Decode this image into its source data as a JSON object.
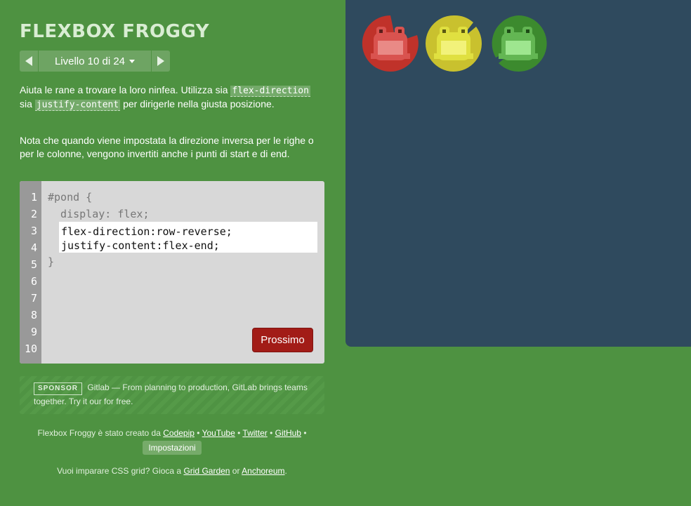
{
  "title": "FLEXBOX FROGGY",
  "level_nav": {
    "label": "Livello 10 di 24",
    "prev_icon": "triangle-left-icon",
    "next_icon": "triangle-right-icon"
  },
  "instructions": {
    "p1_part1": "Aiuta le rane a trovare la loro ninfea. Utilizza sia ",
    "p1_code1": "flex-direction",
    "p1_part2": " sia ",
    "p1_code2": "justify-content",
    "p1_part3": " per dirigerle nella giusta posizione.",
    "p2": "Nota che quando viene impostata la direzione inversa per le righe o per le colonne, vengono invertiti anche i punti di start e di end."
  },
  "editor": {
    "line_numbers": [
      "1",
      "2",
      "3",
      "4",
      "5",
      "6",
      "7",
      "8",
      "9",
      "10"
    ],
    "line1": "#pond {",
    "line2": "  display: flex;",
    "input_value": "flex-direction:row-reverse;\njustify-content:flex-end;",
    "line5": "}",
    "next_button": "Prossimo"
  },
  "sponsor": {
    "badge": "SPONSOR",
    "text": "Gitlab — From planning to production, GitLab brings teams together. Try it our for free."
  },
  "footer": {
    "credit_prefix": "Flexbox Froggy è stato creato da ",
    "link_codepip": "Codepip",
    "link_youtube": "YouTube",
    "link_twitter": "Twitter",
    "link_github": "GitHub",
    "separator": " • ",
    "settings": "Impostazioni",
    "grid_prefix": "Vuoi imparare CSS grid? Gioca a ",
    "link_grid_garden": "Grid Garden",
    "or": " or ",
    "link_anchoreum": "Anchoreum",
    "period": "."
  },
  "pond": {
    "pads": [
      {
        "color_name": "red",
        "pad_color": "#c0322a",
        "frog_color": "#d9534f",
        "frog_light": "#e98a86"
      },
      {
        "color_name": "yellow",
        "pad_color": "#c9c12e",
        "frog_color": "#e0e040",
        "frog_light": "#f2f27a"
      },
      {
        "color_name": "green",
        "pad_color": "#3c8a2e",
        "frog_color": "#63b653",
        "frog_light": "#9ee68f"
      }
    ]
  },
  "colors": {
    "background": "#4e9241",
    "pond": "#2f4a5e",
    "next_button": "#a21c17"
  }
}
